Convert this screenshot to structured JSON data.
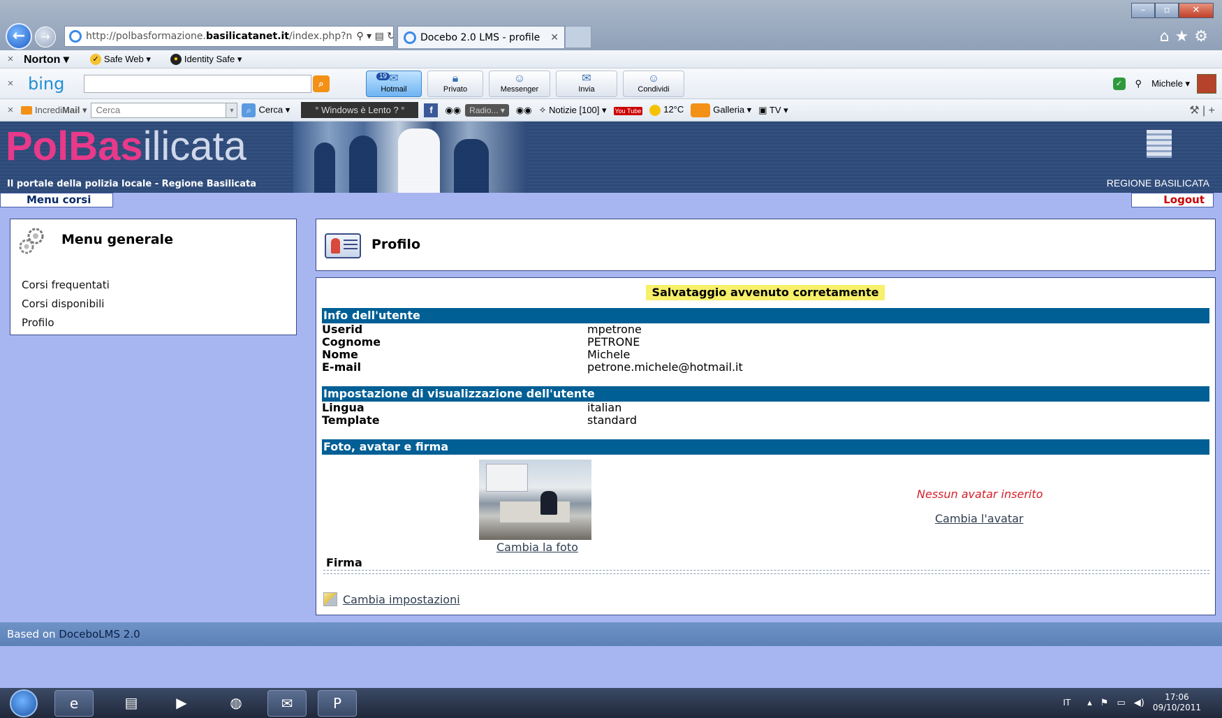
{
  "browser": {
    "url_prefix": "http://polbasformazione.",
    "url_domain": "basilicatanet.it",
    "url_suffix": "/index.php?n",
    "tab_title": "Docebo 2.0 LMS - profile"
  },
  "norton_bar": {
    "brand": "Norton",
    "safe_web": "Safe Web",
    "identity_safe": "Identity Safe"
  },
  "bing_bar": {
    "logo": "bing",
    "buttons": [
      {
        "label": "Hotmail",
        "badge": "19"
      },
      {
        "label": "Privato"
      },
      {
        "label": "Messenger"
      },
      {
        "label": "Invia"
      },
      {
        "label": "Condividi"
      }
    ],
    "user": "Michele"
  },
  "incredimail_bar": {
    "brand_a": "Incredi",
    "brand_b": "Mail",
    "search_placeholder": "Cerca",
    "search_button": "Cerca",
    "slogan": "° Windows è Lento ? °",
    "radio": "Radio...",
    "notizie": "Notizie [100]",
    "youtube": "You Tube",
    "temperature": "12°C",
    "galleria": "Galleria",
    "tv": "TV"
  },
  "site": {
    "logo_pol": "Pol",
    "logo_bas": "Bas",
    "logo_rest": "ilicata",
    "subtitle": "Il portale della polizia locale - Regione Basilicata",
    "region": "REGIONE BASILICATA"
  },
  "menubar": {
    "courses_menu": "Menu corsi",
    "logout": "Logout"
  },
  "sidebar": {
    "title": "Menu generale",
    "items": [
      "Corsi frequentati",
      "Corsi disponibili",
      "Profilo"
    ]
  },
  "profile": {
    "title": "Profilo",
    "success_message": "Salvataggio avvenuto corretamente",
    "user_info": {
      "heading": "Info dell'utente",
      "rows": [
        {
          "label": "Userid",
          "value": "mpetrone"
        },
        {
          "label": "Cognome",
          "value": "PETRONE"
        },
        {
          "label": "Nome",
          "value": "Michele"
        },
        {
          "label": "E-mail",
          "value": "petrone.michele@hotmail.it"
        }
      ]
    },
    "display_settings": {
      "heading": "Impostazione di visualizzazione dell'utente",
      "rows": [
        {
          "label": "Lingua",
          "value": "italian"
        },
        {
          "label": "Template",
          "value": "standard"
        }
      ]
    },
    "photo_section": {
      "heading": "Foto, avatar e firma",
      "change_photo": "Cambia la foto",
      "no_avatar": "Nessun avatar inserito",
      "change_avatar": "Cambia l'avatar",
      "signature_label": "Firma"
    },
    "change_settings": "Cambia impostazioni"
  },
  "footer": {
    "prefix": "Based on ",
    "brand": "DoceboLMS 2.0"
  },
  "taskbar": {
    "lang": "IT",
    "time": "17:06",
    "date": "09/10/2011"
  }
}
